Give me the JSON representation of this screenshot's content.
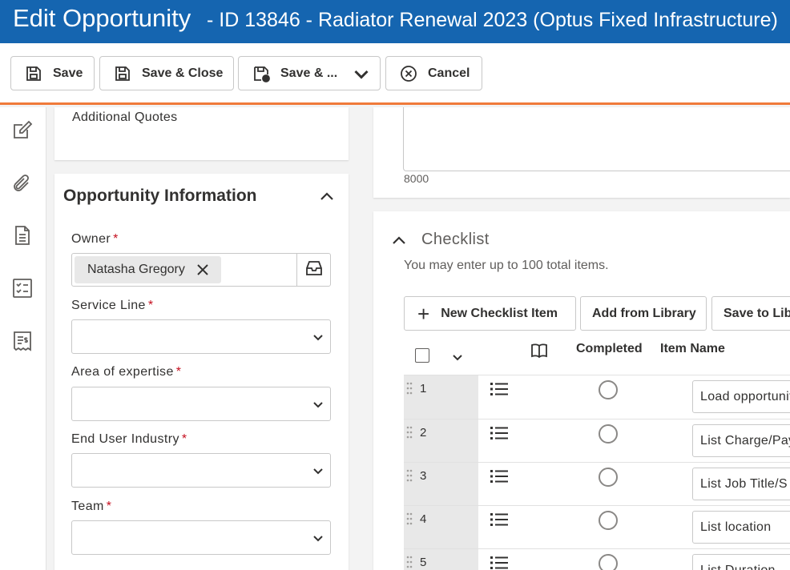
{
  "header": {
    "title": "Edit Opportunity",
    "subtitle": " - ID 13846 - Radiator Renewal 2023 (Optus Fixed Infrastructure)"
  },
  "toolbar": {
    "save_label": "Save",
    "save_close_label": "Save & Close",
    "save_more_label": "Save & ...",
    "cancel_label": "Cancel"
  },
  "rail": {
    "icons": [
      "edit-icon",
      "paperclip-icon",
      "document-icon",
      "checklist-icon",
      "receipt-icon"
    ]
  },
  "additional_quotes": {
    "label": "Additional Quotes"
  },
  "opportunity_info": {
    "title": "Opportunity Information",
    "owner_label": "Owner",
    "owner_value": "Natasha Gregory",
    "service_line_label": "Service Line",
    "area_label": "Area of expertise",
    "industry_label": "End User Industry",
    "team_label": "Team",
    "required_mark": "*"
  },
  "description": {
    "char_count": "8000"
  },
  "checklist": {
    "title": "Checklist",
    "hint": "You may enter up to 100 total items.",
    "new_item_label": "New Checklist Item",
    "add_library_label": "Add from Library",
    "save_library_label": "Save to Library",
    "columns": {
      "completed": "Completed",
      "item_name": "Item Name"
    },
    "rows": [
      {
        "num": "1",
        "name": "Load opportunity"
      },
      {
        "num": "2",
        "name": "List Charge/Pay"
      },
      {
        "num": "3",
        "name": "List Job Title/S"
      },
      {
        "num": "4",
        "name": "List location"
      },
      {
        "num": "5",
        "name": "List Duration"
      }
    ]
  },
  "colors": {
    "header_bg": "#1565b0",
    "accent_orange": "#f07a3a",
    "required_red": "#c50f1f"
  }
}
